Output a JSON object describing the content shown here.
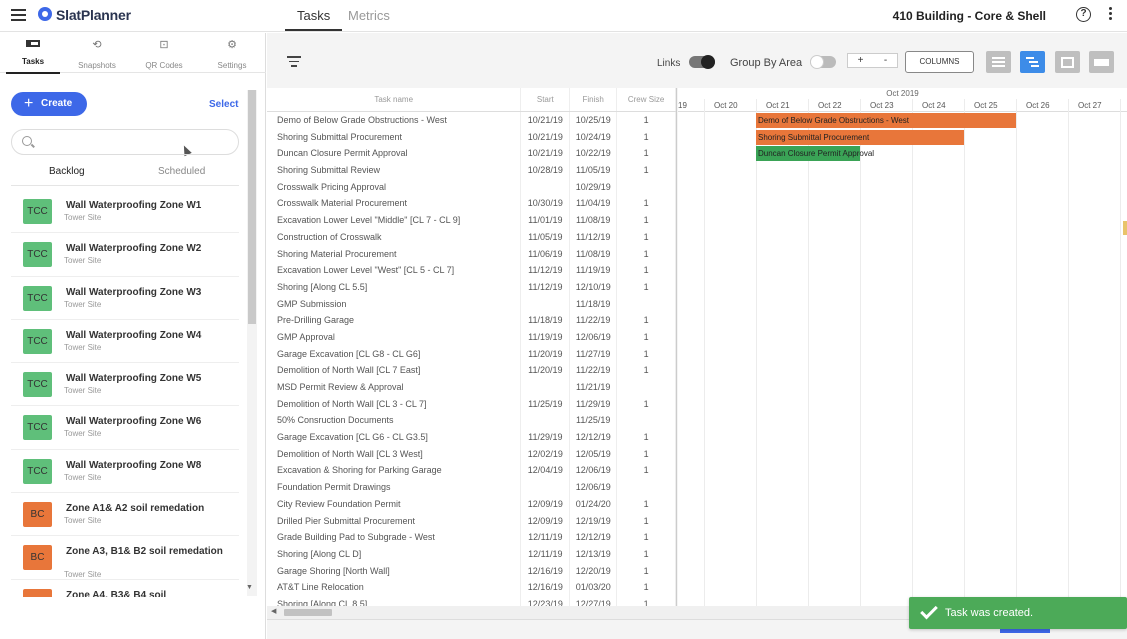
{
  "header": {
    "brand": "SlatPlanner",
    "tabs": [
      {
        "label": "Tasks",
        "active": true
      },
      {
        "label": "Metrics",
        "active": false
      }
    ],
    "project_title": "410 Building - Core & Shell",
    "help_glyph": "?"
  },
  "sidebar": {
    "tabs": [
      {
        "label": "Tasks",
        "icon": "tasks-icon"
      },
      {
        "label": "Snapshots",
        "icon": "history-icon"
      },
      {
        "label": "QR Codes",
        "icon": "qr-code-icon"
      },
      {
        "label": "Settings",
        "icon": "gear-icon"
      }
    ],
    "create_label": "Create",
    "select_label": "Select",
    "search_placeholder": "",
    "sub_tabs": [
      {
        "label": "Backlog",
        "active": true
      },
      {
        "label": "Scheduled",
        "active": false
      }
    ],
    "tasks": [
      {
        "badge": "TCC",
        "badge_color": "#5fbf7a",
        "name": "Wall Waterproofing Zone W1",
        "site": "Tower Site"
      },
      {
        "badge": "TCC",
        "badge_color": "#5fbf7a",
        "name": "Wall Waterproofing Zone W2",
        "site": "Tower Site"
      },
      {
        "badge": "TCC",
        "badge_color": "#5fbf7a",
        "name": "Wall Waterproofing Zone W3",
        "site": "Tower Site"
      },
      {
        "badge": "TCC",
        "badge_color": "#5fbf7a",
        "name": "Wall Waterproofing Zone W4",
        "site": "Tower Site"
      },
      {
        "badge": "TCC",
        "badge_color": "#5fbf7a",
        "name": "Wall Waterproofing Zone W5",
        "site": "Tower Site"
      },
      {
        "badge": "TCC",
        "badge_color": "#5fbf7a",
        "name": "Wall Waterproofing Zone W6",
        "site": "Tower Site"
      },
      {
        "badge": "TCC",
        "badge_color": "#5fbf7a",
        "name": "Wall Waterproofing Zone W8",
        "site": "Tower Site"
      },
      {
        "badge": "BC",
        "badge_color": "#e8763a",
        "name": "Zone A1& A2 soil remedation",
        "site": "Tower Site"
      },
      {
        "badge": "BC",
        "badge_color": "#e8763a",
        "name": "Zone A3, B1& B2 soil remedation",
        "site": "Tower Site"
      },
      {
        "badge": "",
        "badge_color": "#e8763a",
        "name": "Zone A4, B3& B4 soil",
        "site": ""
      }
    ]
  },
  "toolbar": {
    "links_label": "Links",
    "links_on": true,
    "group_by_area_label": "Group By Area",
    "group_by_area_on": false,
    "zoom_in": "+",
    "zoom_out": "-",
    "columns_label": "COLUMNS"
  },
  "grid": {
    "columns": [
      "Task name",
      "Start",
      "Finish",
      "Crew Size"
    ],
    "rows": [
      [
        "Demo of Below Grade Obstructions - West",
        "10/21/19",
        "10/25/19",
        "1"
      ],
      [
        "Shoring Submittal Procurement",
        "10/21/19",
        "10/24/19",
        "1"
      ],
      [
        "Duncan Closure Permit Approval",
        "10/21/19",
        "10/22/19",
        "1"
      ],
      [
        "Shoring Submittal Review",
        "10/28/19",
        "11/05/19",
        "1"
      ],
      [
        "Crosswalk Pricing Approval",
        "",
        "10/29/19",
        ""
      ],
      [
        "Crosswalk Material Procurement",
        "10/30/19",
        "11/04/19",
        "1"
      ],
      [
        "Excavation Lower Level \"Middle\" [CL 7 - CL 9]",
        "11/01/19",
        "11/08/19",
        "1"
      ],
      [
        "Construction of Crosswalk",
        "11/05/19",
        "11/12/19",
        "1"
      ],
      [
        "Shoring Material Procurement",
        "11/06/19",
        "11/08/19",
        "1"
      ],
      [
        "Excavation Lower Level \"West\" [CL 5 - CL 7]",
        "11/12/19",
        "11/19/19",
        "1"
      ],
      [
        "Shoring [Along CL 5.5]",
        "11/12/19",
        "12/10/19",
        "1"
      ],
      [
        "GMP Submission",
        "",
        "11/18/19",
        ""
      ],
      [
        "Pre-Drilling Garage",
        "11/18/19",
        "11/22/19",
        "1"
      ],
      [
        "GMP Approval",
        "11/19/19",
        "12/06/19",
        "1"
      ],
      [
        "Garage Excavation [CL G8 - CL G6]",
        "11/20/19",
        "11/27/19",
        "1"
      ],
      [
        "Demolition of North Wall [CL 7 East]",
        "11/20/19",
        "11/22/19",
        "1"
      ],
      [
        "MSD Permit Review & Approval",
        "",
        "11/21/19",
        ""
      ],
      [
        "Demolition of North Wall [CL 3 - CL 7]",
        "11/25/19",
        "11/29/19",
        "1"
      ],
      [
        "50% Consruction Documents",
        "",
        "11/25/19",
        ""
      ],
      [
        "Garage Excavation [CL G6 - CL G3.5]",
        "11/29/19",
        "12/12/19",
        "1"
      ],
      [
        "Demolition of North Wall [CL 3 West]",
        "12/02/19",
        "12/05/19",
        "1"
      ],
      [
        "Excavation & Shoring for Parking Garage",
        "12/04/19",
        "12/06/19",
        "1"
      ],
      [
        "Foundation Permit Drawings",
        "",
        "12/06/19",
        ""
      ],
      [
        "City Review Foundation Permit",
        "12/09/19",
        "01/24/20",
        "1"
      ],
      [
        "Drilled Pier Submittal Procurement",
        "12/09/19",
        "12/19/19",
        "1"
      ],
      [
        "Grade Building Pad to Subgrade - West",
        "12/11/19",
        "12/12/19",
        "1"
      ],
      [
        "Shoring [Along CL D]",
        "12/11/19",
        "12/13/19",
        "1"
      ],
      [
        "Garage Shoring [North Wall]",
        "12/16/19",
        "12/20/19",
        "1"
      ],
      [
        "AT&T Line Relocation",
        "12/16/19",
        "01/03/20",
        "1"
      ],
      [
        "Shoring [Along CL 8.5]",
        "12/23/19",
        "12/27/19",
        "1"
      ]
    ]
  },
  "gantt": {
    "month_label": "Oct 2019",
    "day_labels": [
      "19",
      "Oct 20",
      "Oct 21",
      "Oct 22",
      "Oct 23",
      "Oct 24",
      "Oct 25",
      "Oct 26",
      "Oct 27"
    ],
    "bars": [
      {
        "label": "Demo of Below Grade Obstructions - West",
        "color": "#e8763a",
        "start": "10/21/19",
        "finish": "10/25/19"
      },
      {
        "label": "Shoring Submittal Procurement",
        "color": "#e8763a",
        "start": "10/21/19",
        "finish": "10/24/19"
      },
      {
        "label": "Duncan Closure Permit Approval",
        "color": "#3aa356",
        "start": "10/21/19",
        "finish": "10/22/19"
      }
    ]
  },
  "toast": {
    "message": "Task was created."
  }
}
